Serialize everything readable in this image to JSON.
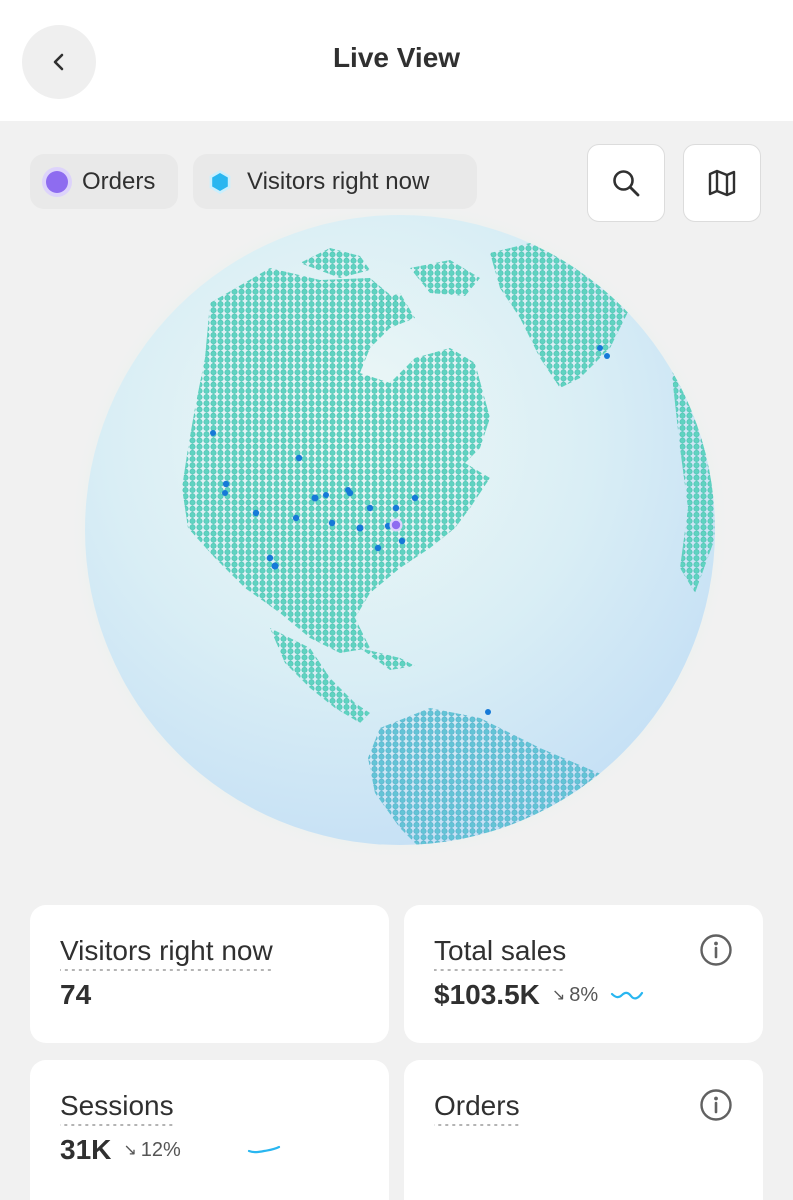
{
  "header": {
    "title": "Live View",
    "back_icon": "chevron-left-icon"
  },
  "legend": {
    "orders_label": "Orders",
    "visitors_label": "Visitors right now",
    "orders_color": "#8e6cf0",
    "visitors_color": "#29b6f0"
  },
  "toolbar": {
    "search_icon": "search-icon",
    "map_icon": "map-icon"
  },
  "globe": {
    "land_color": "#5fd3c1",
    "ocean_color": "#d8ecf3",
    "visitor_dot_color": "#1679d8",
    "order_dot_color": "#8e6cf0"
  },
  "metrics": {
    "visitors": {
      "label": "Visitors right now",
      "value": "74"
    },
    "total_sales": {
      "label": "Total sales",
      "value": "$103.5K",
      "change": "8%",
      "change_arrow": "↘"
    },
    "sessions": {
      "label": "Sessions",
      "value": "31K",
      "change": "12%",
      "change_arrow": "↘"
    },
    "orders": {
      "label": "Orders"
    }
  }
}
